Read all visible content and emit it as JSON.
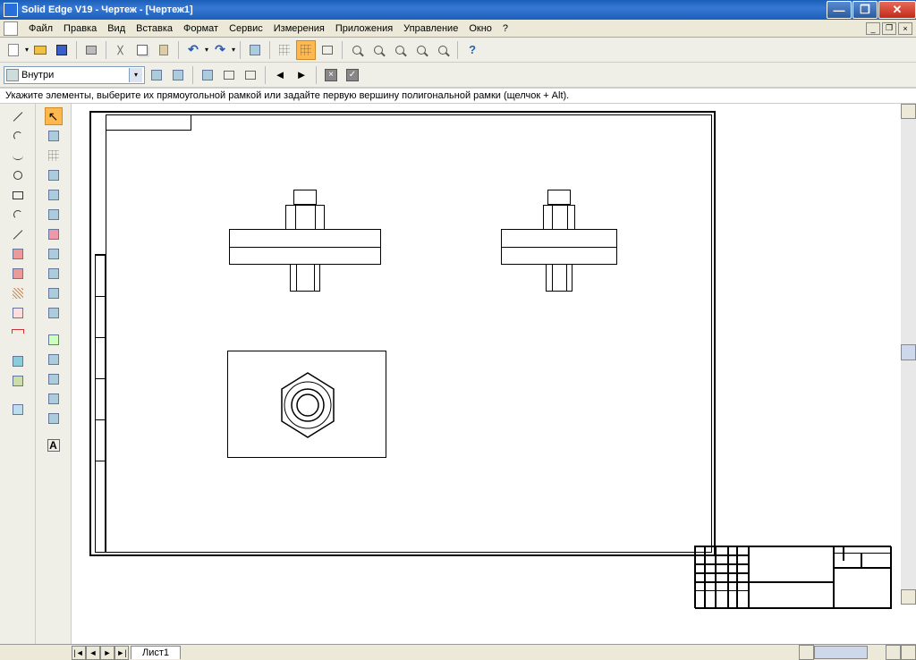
{
  "title": "Solid Edge V19 - Чертеж - [Чертеж1]",
  "menus": [
    "Файл",
    "Правка",
    "Вид",
    "Вставка",
    "Формат",
    "Сервис",
    "Измерения",
    "Приложения",
    "Управление",
    "Окно",
    "?"
  ],
  "combo_value": "Внутри",
  "prompt": "Укажите элементы, выберите их прямоугольной рамкой или задайте первую вершину полигональной рамки (щелчок + Alt).",
  "sheet_tab": "Лист1",
  "window_buttons": {
    "min": "—",
    "max": "❐",
    "close": "✕"
  },
  "mdi_buttons": {
    "min": "_",
    "max": "❐",
    "close": "×"
  },
  "arrows": {
    "left": "◄",
    "right": "►",
    "undo": "↶",
    "redo": "↷",
    "undo_d": "▾",
    "redo_d": "▾"
  },
  "help": "?",
  "text_A": "A",
  "check": "✓",
  "x": "×",
  "cursor": "↖",
  "nav": [
    "|◄",
    "◄",
    "►",
    "►|"
  ]
}
